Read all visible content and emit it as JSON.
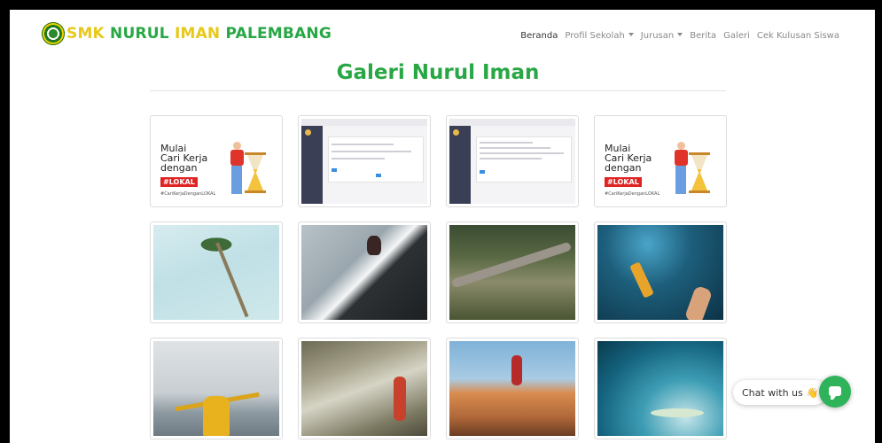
{
  "brand": {
    "part1": "SMK",
    "part2": " NURUL ",
    "part3": "IMAN",
    "part4": " PALEMBANG",
    "logo_icon": "school-emblem-icon"
  },
  "nav": {
    "beranda": "Beranda",
    "profil": "Profil Sekolah",
    "jurusan": "Jurusan",
    "berita": "Berita",
    "galeri": "Galeri",
    "cek": "Cek Kulusan Siswa"
  },
  "page": {
    "title": "Galeri Nurul Iman"
  },
  "gallery": {
    "ads": [
      {
        "line1": "Mulai",
        "line2": "Cari Kerja",
        "line3": "dengan",
        "badge": "#LOKAL",
        "tag": "#CariKerjaDenganLOKAL"
      },
      {
        "line1": "Mulai",
        "line2": "Cari Kerja",
        "line3": "dengan",
        "badge": "#LOKAL",
        "tag": "#CariKerjaDenganLOKAL"
      }
    ]
  },
  "chat": {
    "label": "Chat with us",
    "wave": "👋",
    "icon": "chat-bubble-icon"
  },
  "colors": {
    "brand_green": "#28a745",
    "brand_yellow": "#e8c81a",
    "chat_green": "#2fb35a"
  }
}
